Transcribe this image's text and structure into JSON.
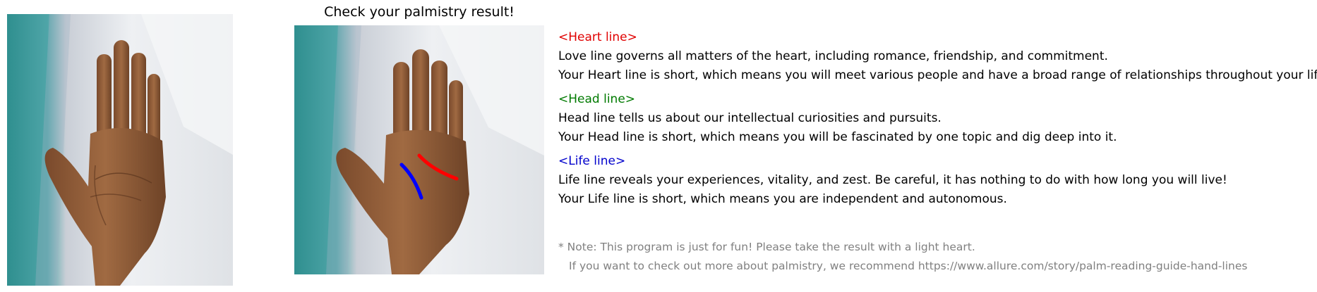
{
  "title": "Check your palmistry result!",
  "sections": [
    {
      "heading": "<Heart line>",
      "color": "#e00000",
      "lines": [
        "Love line governs all matters of the heart, including romance, friendship, and commitment.",
        "Your Heart line is short, which means you will meet various people and have a broad range of relationships throughout your life."
      ]
    },
    {
      "heading": "<Head line>",
      "color": "#007a00",
      "lines": [
        "Head line tells us about our intellectual curiosities and pursuits.",
        "Your Head line is short, which means you will be fascinated by one topic and dig deep into it."
      ]
    },
    {
      "heading": "<Life line>",
      "color": "#0000cc",
      "lines": [
        "Life line reveals your experiences, vitality, and zest. Be careful, it has nothing to do with how long you will live!",
        "Your Life line is short, which means you are independent and autonomous."
      ]
    }
  ],
  "note": {
    "line1": "* Note: This program is just for fun! Please take the result with a light heart.",
    "line2": "If you want to check out more about palmistry, we recommend https://www.allure.com/story/palm-reading-guide-hand-lines"
  },
  "palm_lines_overlay": {
    "heart_line_color": "#ff0000",
    "life_line_color": "#0000ff"
  }
}
